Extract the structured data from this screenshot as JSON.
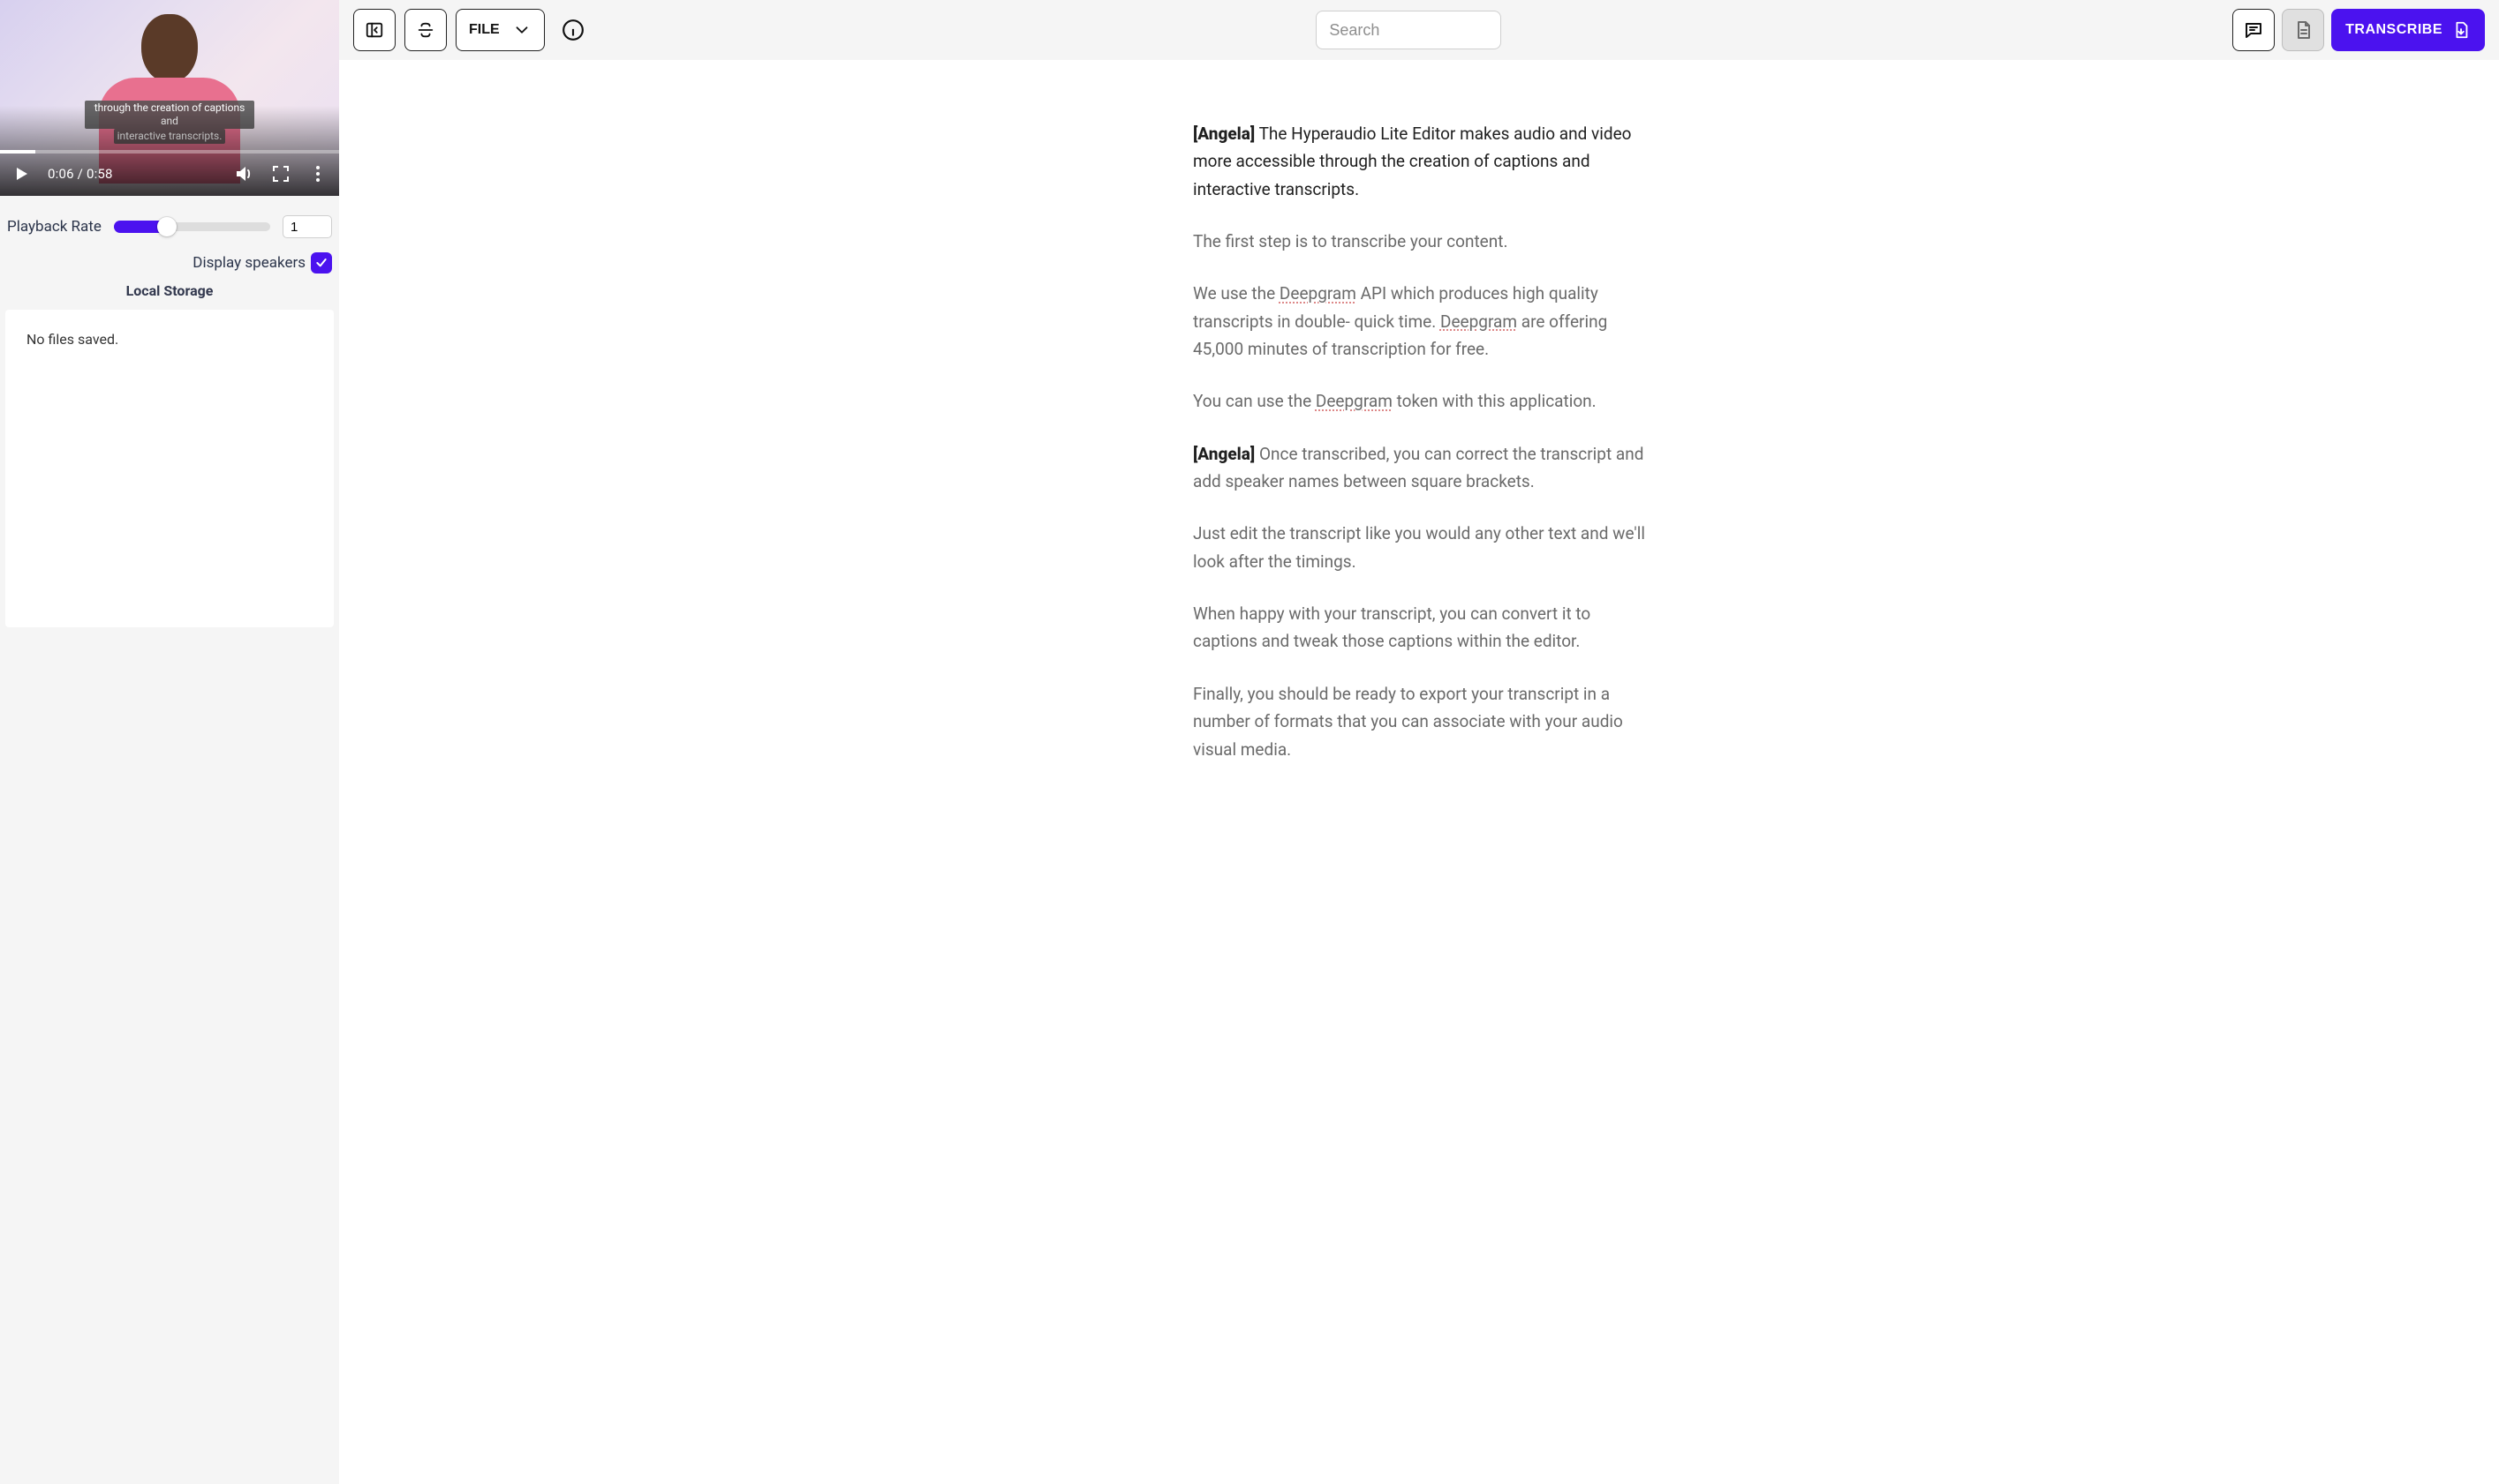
{
  "video": {
    "subtitle_line1": "through the creation of captions and",
    "subtitle_line2": "interactive transcripts.",
    "time": "0:06 / 0:58",
    "progress_pct": 10.3
  },
  "sidebar": {
    "playback_label": "Playback Rate",
    "playback_value": "1",
    "display_speakers_label": "Display speakers",
    "display_speakers_checked": true,
    "local_storage_heading": "Local Storage",
    "local_storage_empty": "No files saved."
  },
  "toolbar": {
    "file_label": "FILE",
    "search_placeholder": "Search",
    "transcribe_label": "TRANSCRIBE"
  },
  "transcript": {
    "p1_speaker": "[Angela]",
    "p1_text": " The Hyperaudio Lite Editor makes audio and video more accessible through the creation of captions and interactive transcripts.",
    "p2": "The first step is to transcribe your content.",
    "p3a": "We use the ",
    "p3_dg1": "Deepgram",
    "p3b": " API which produces high quality transcripts in double- quick time. ",
    "p3_dg2": "Deepgram",
    "p3c": " are offering 45,000 minutes of transcription for free.",
    "p4a": "You can use the ",
    "p4_dg": "Deepgram",
    "p4b": " token with this application.",
    "p5_speaker": "[Angela]",
    "p5_text": " Once transcribed, you can correct the transcript and add speaker names between square brackets.",
    "p6": "Just edit the transcript like you would any other text and we'll look after the timings.",
    "p7": "When happy with your transcript, you can convert it to captions and tweak those captions within the editor.",
    "p8": "Finally, you should be ready to export your transcript in a number of formats that you can associate with your audio visual media."
  }
}
